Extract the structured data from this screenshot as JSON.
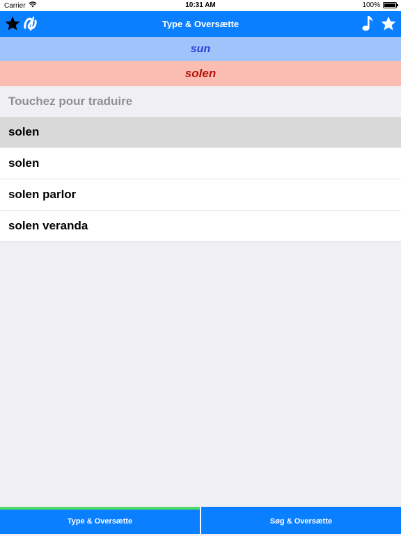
{
  "status_bar": {
    "carrier": "Carrier",
    "time": "10:31 AM",
    "battery": "100%"
  },
  "nav": {
    "title": "Type & Oversætte",
    "left_icons": [
      "star-icon",
      "app-logo-icon"
    ],
    "right_icons": [
      "music-note-icon",
      "star-icon"
    ]
  },
  "source_text": "sun",
  "target_text": "solen",
  "hint_text": "Touchez pour traduire",
  "results": [
    {
      "label": "solen",
      "selected": true
    },
    {
      "label": "solen",
      "selected": false
    },
    {
      "label": "solen parlor",
      "selected": false
    },
    {
      "label": "solen veranda",
      "selected": false
    }
  ],
  "tabs": [
    {
      "label": "Type & Oversætte",
      "active": true
    },
    {
      "label": "Søg & Oversætte",
      "active": false
    }
  ],
  "colors": {
    "accent": "#0a7fff",
    "source_bg": "#9fc3fb",
    "source_text": "#2f3fd6",
    "target_bg": "#fbbdb2",
    "target_text": "#b3130b",
    "tab_active_indicator": "#4cd964"
  }
}
